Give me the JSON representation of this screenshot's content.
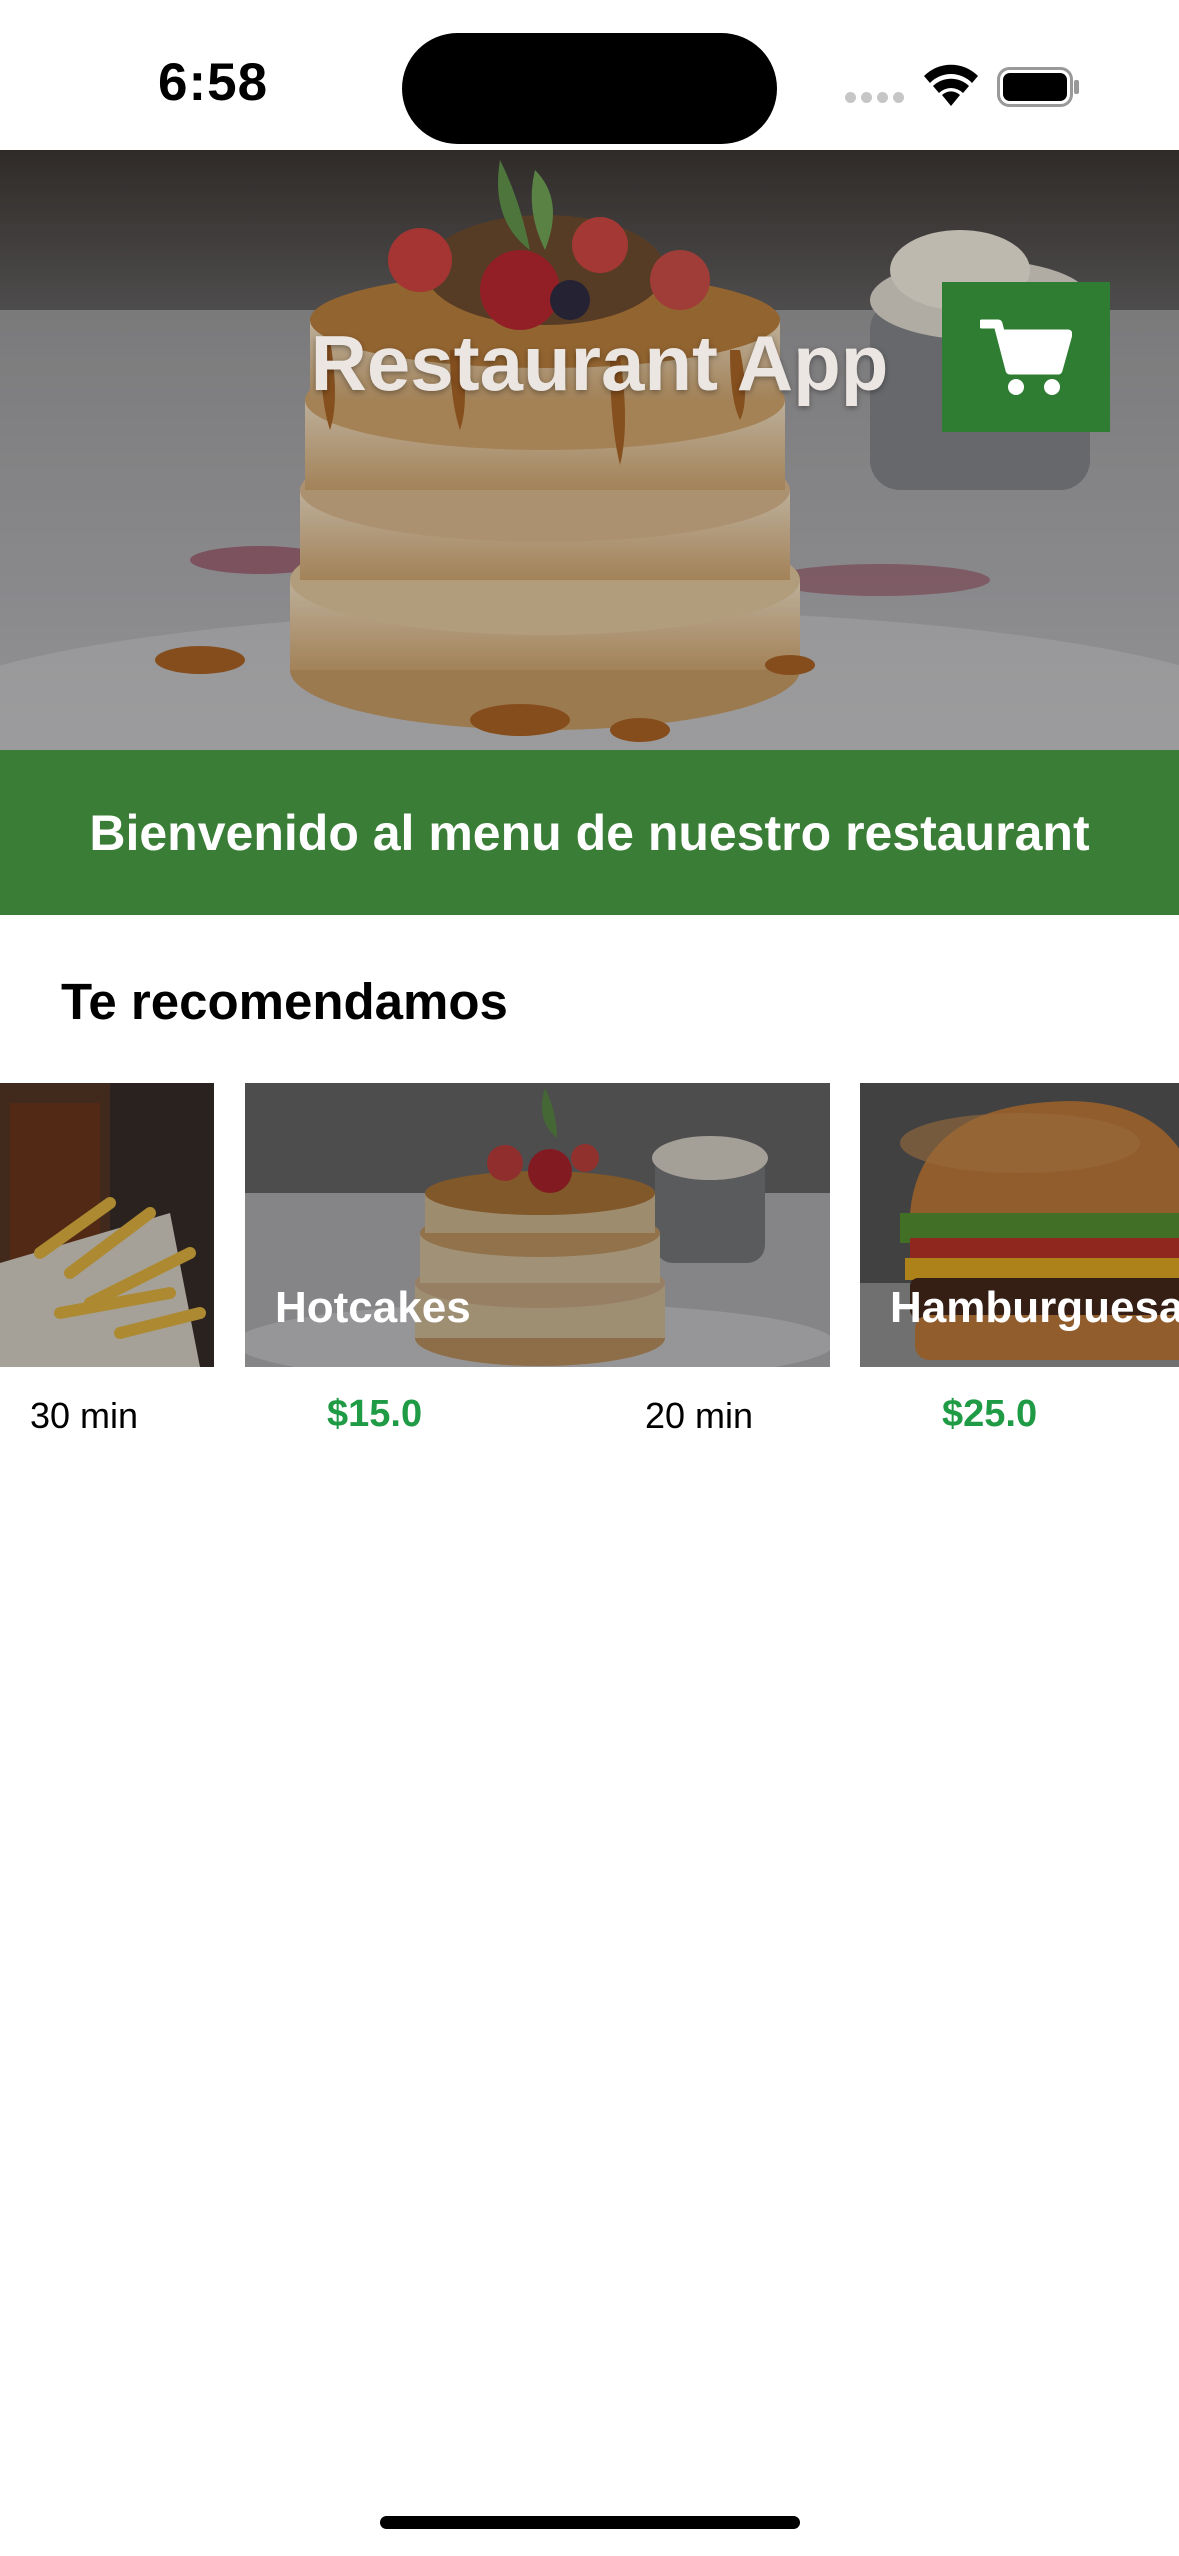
{
  "status_bar": {
    "time": "6:58"
  },
  "header": {
    "title": "Restaurant App",
    "cart_icon": "shopping-cart-icon",
    "accent_color": "#2e7d32"
  },
  "banner": {
    "text": "Bienvenido al menu de nuestro restaurant",
    "color": "#3a7d36"
  },
  "recommendations": {
    "title": "Te recomendamos",
    "items": [
      {
        "name": "",
        "time": "30 min",
        "price": ""
      },
      {
        "name": "Hotcakes",
        "time": "20 min",
        "price": "$15.0"
      },
      {
        "name": "Hamburguesa",
        "time": "",
        "price": "$25.0"
      }
    ]
  }
}
